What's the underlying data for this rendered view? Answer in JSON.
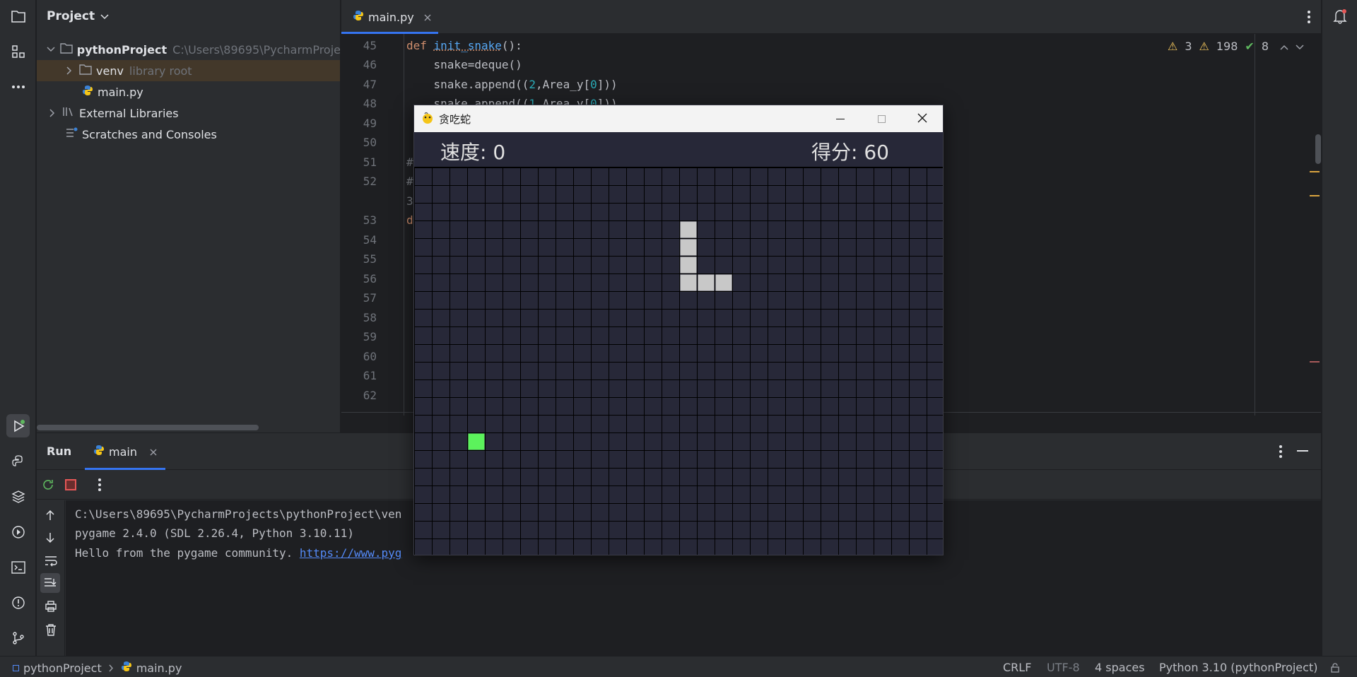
{
  "project_panel": {
    "title": "Project",
    "root_name": "pythonProject",
    "root_path": "C:\\Users\\89695\\PycharmProje",
    "venv_label": "venv",
    "venv_hint": "library root",
    "main_file": "main.py",
    "external_libraries": "External Libraries",
    "scratches": "Scratches and Consoles"
  },
  "editor": {
    "tab_label": "main.py",
    "inspection": {
      "errors": "3",
      "warnings": "198",
      "ok": "8"
    },
    "line_numbers": [
      "45",
      "46",
      "47",
      "48",
      "49",
      "50",
      "51",
      "52",
      "",
      "53",
      "54",
      "55",
      "56",
      "57",
      "58",
      "59",
      "60",
      "61",
      "62"
    ],
    "code": {
      "l45_kw": "def",
      "l45_fn": "init_snake",
      "l45_rest": "():",
      "l46": "    snake=deque()",
      "l47a": "    snake.append((",
      "l47b": "2",
      "l47c": ",Area_y[",
      "l47d": "0",
      "l47e": "]))",
      "l48a": "    snake.append((",
      "l48b": "1",
      "l48c": ",Area_y[",
      "l48d": "0",
      "l48e": "]))",
      "l51": "#",
      "l52": "#",
      "l52b": "3",
      "l53": "d"
    }
  },
  "run_panel": {
    "tab_run": "Run",
    "tab_main": "main",
    "console_lines": [
      "C:\\Users\\89695\\PycharmProjects\\pythonProject\\ven",
      "pygame 2.4.0 (SDL 2.26.4, Python 3.10.11)",
      "Hello from the pygame community. "
    ],
    "console_link": "https://www.pyg"
  },
  "status_bar": {
    "breadcrumb_project": "pythonProject",
    "breadcrumb_file": "main.py",
    "line_sep": "CRLF",
    "encoding": "UTF-8",
    "indent": "4 spaces",
    "interpreter": "Python 3.10 (pythonProject)"
  },
  "game": {
    "window_title": "贪吃蛇",
    "speed_label": "速度: 0",
    "score_label": "得分: 60",
    "grid_cols": 30,
    "grid_rows": 22,
    "snake_cells": [
      [
        15,
        3
      ],
      [
        15,
        4
      ],
      [
        15,
        5
      ],
      [
        15,
        6
      ],
      [
        16,
        6
      ],
      [
        17,
        6
      ]
    ],
    "food_cell": [
      3,
      15
    ],
    "colors": {
      "background": "#272838",
      "grid_line": "#000000",
      "snake": "#c8c8c8",
      "food": "#5cf25c"
    }
  },
  "colors": {
    "accent": "#3574f0",
    "link": "#548af7",
    "keyword": "#cf8e6d",
    "function": "#56a8f5",
    "number": "#2aacb8"
  }
}
